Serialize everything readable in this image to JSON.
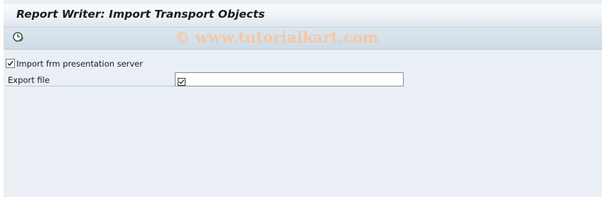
{
  "window": {
    "title": "Report Writer: Import Transport Objects"
  },
  "toolbar": {
    "execute_icon": "execute-clock-icon",
    "watermark": "© www.tutorialkart.com"
  },
  "form": {
    "import_checkbox": {
      "label": "Import frm presentation server",
      "checked": true
    },
    "export_file": {
      "label": "Export file",
      "value": "",
      "required_icon": "required-checkbox-icon"
    }
  }
}
